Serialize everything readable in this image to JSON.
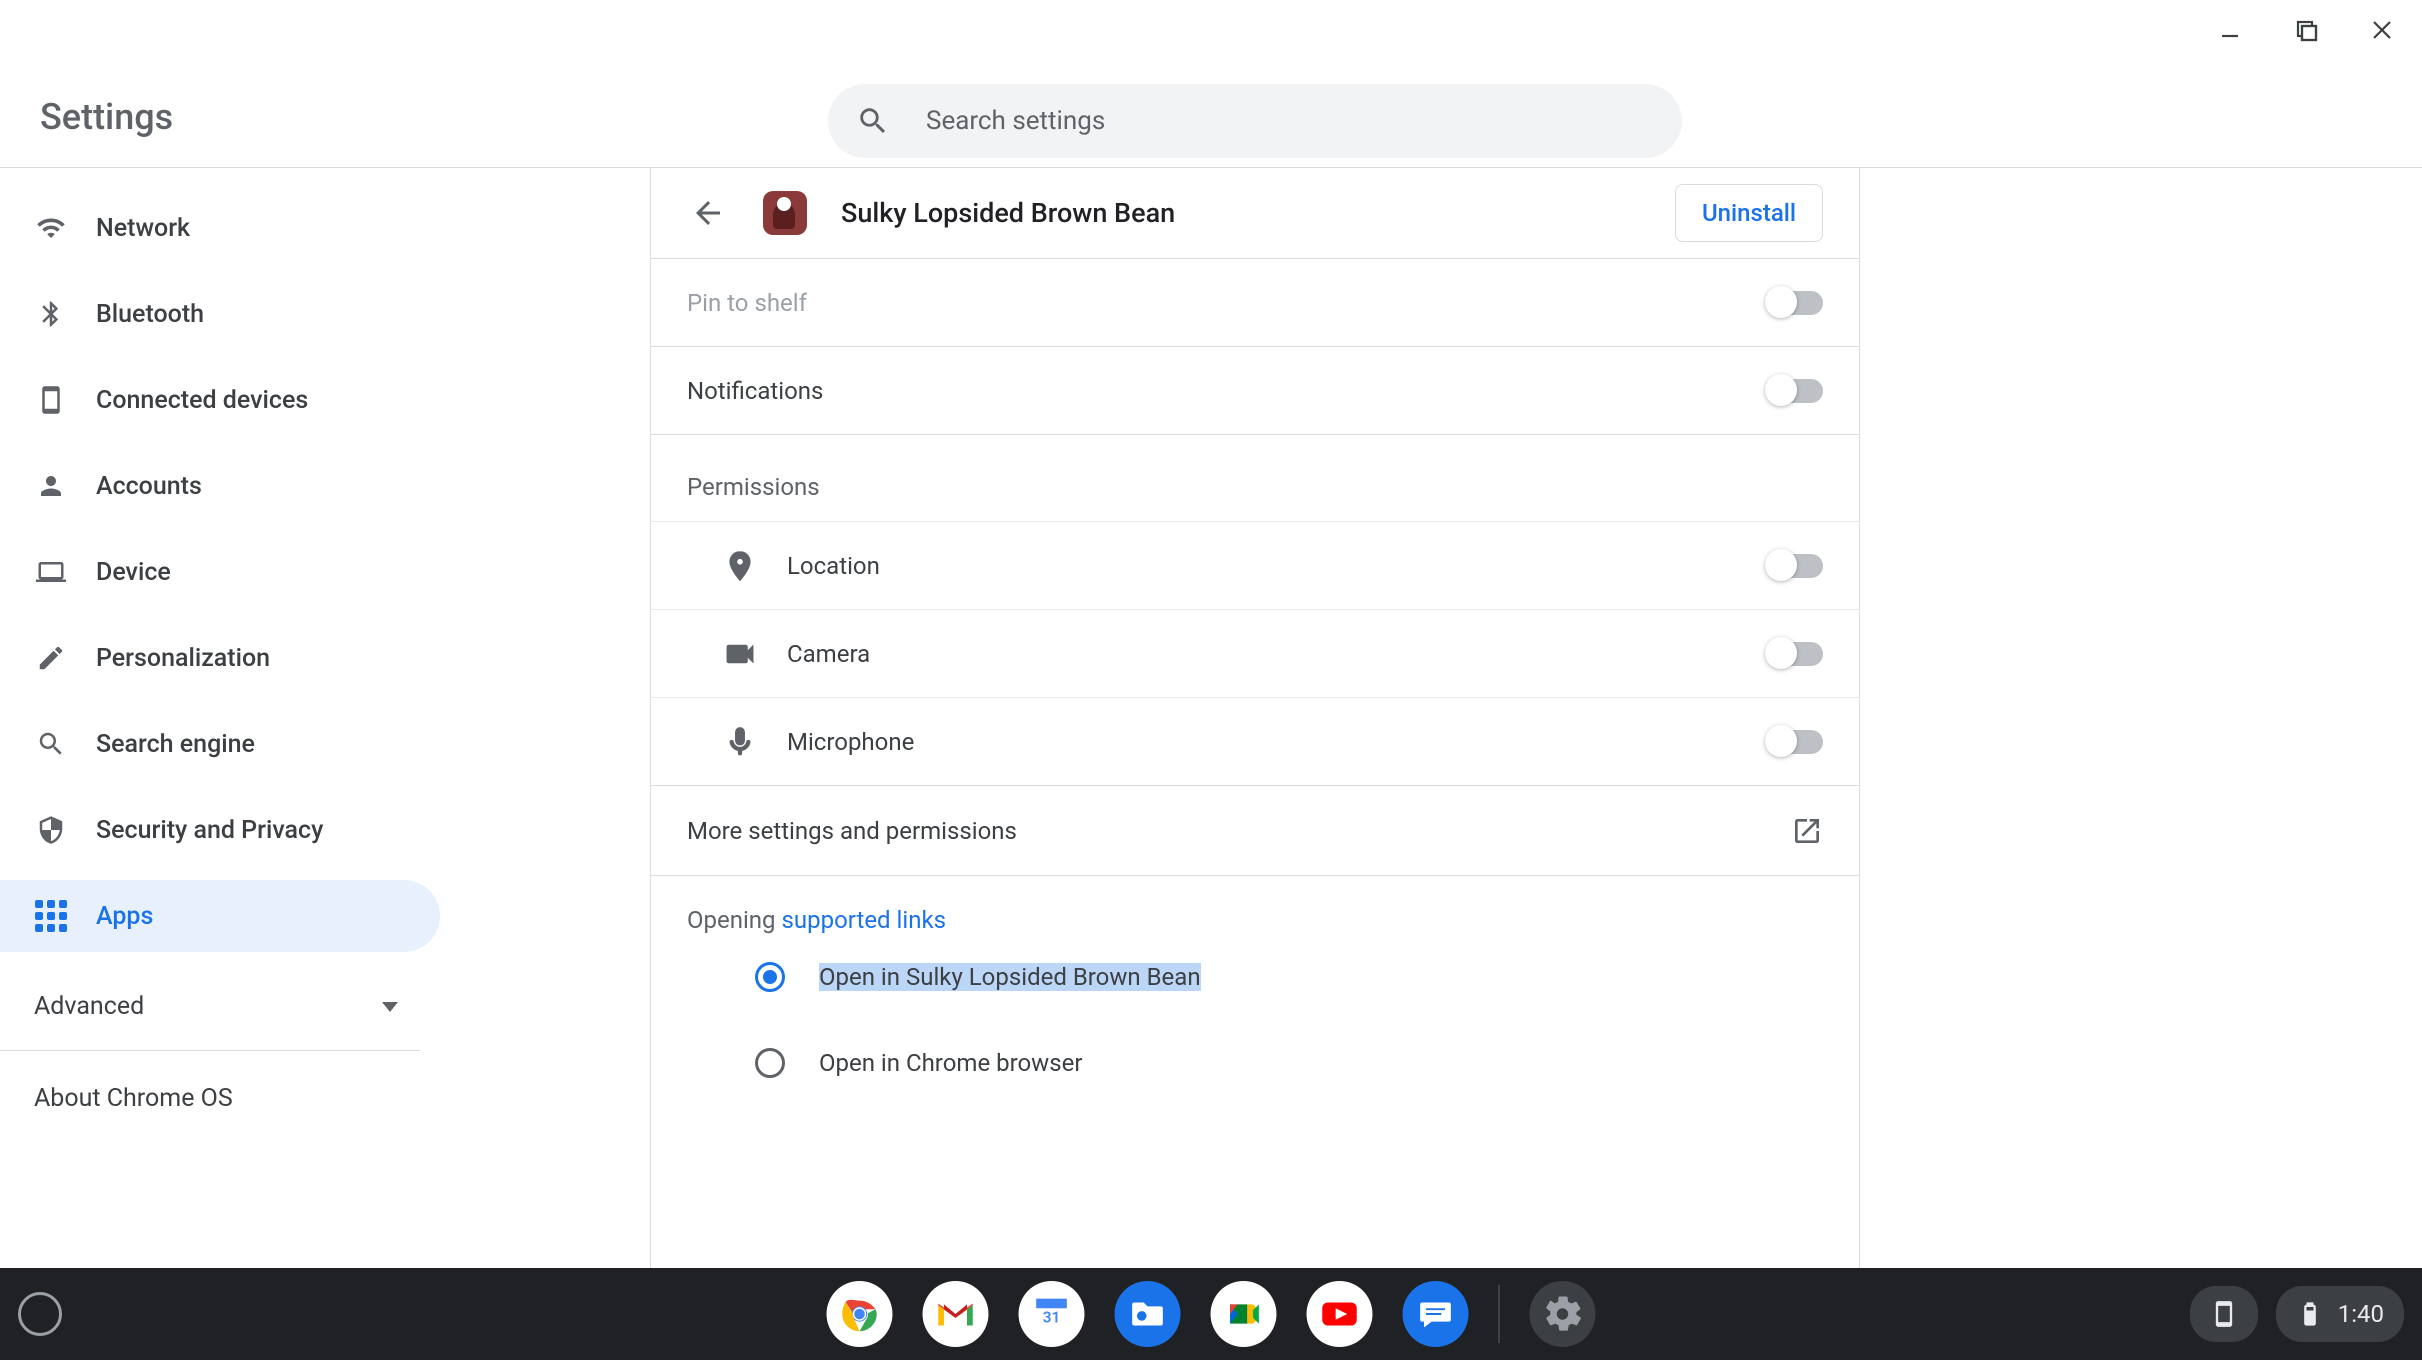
{
  "header": {
    "title": "Settings",
    "search_placeholder": "Search settings"
  },
  "sidebar": {
    "items": [
      {
        "label": "Network"
      },
      {
        "label": "Bluetooth"
      },
      {
        "label": "Connected devices"
      },
      {
        "label": "Accounts"
      },
      {
        "label": "Device"
      },
      {
        "label": "Personalization"
      },
      {
        "label": "Search engine"
      },
      {
        "label": "Security and Privacy"
      },
      {
        "label": "Apps"
      }
    ],
    "advanced_label": "Advanced",
    "about_label": "About Chrome OS"
  },
  "app": {
    "name": "Sulky Lopsided Brown Bean",
    "uninstall_label": "Uninstall",
    "pin_label": "Pin to shelf",
    "notifications_label": "Notifications",
    "permissions_title": "Permissions",
    "permissions": [
      {
        "label": "Location"
      },
      {
        "label": "Camera"
      },
      {
        "label": "Microphone"
      }
    ],
    "more_label": "More settings and permissions",
    "links_prefix": "Opening ",
    "links_link": "supported links",
    "radio_options": [
      {
        "label": "Open in Sulky Lopsided Brown Bean",
        "checked": true
      },
      {
        "label": "Open in Chrome browser",
        "checked": false
      }
    ]
  },
  "shelf": {
    "apps": [
      "chrome",
      "gmail",
      "calendar",
      "files",
      "meet",
      "youtube",
      "messages",
      "settings"
    ],
    "time": "1:40"
  }
}
